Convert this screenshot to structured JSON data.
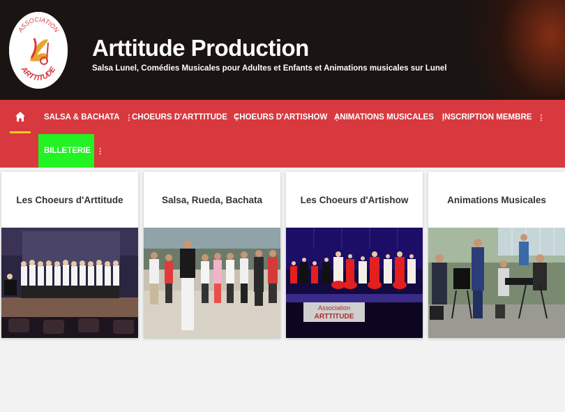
{
  "header": {
    "logo_text_top": "ASSOCIATION",
    "logo_text_bottom": "ARTTITUDE",
    "title": "Arttitude Production",
    "tagline": "Salsa Lunel, Comédies Musicales pour Adultes et Enfants et Animations musicales sur Lunel"
  },
  "nav": {
    "home_icon": "home-icon",
    "items": [
      {
        "label": "SALSA & BACHATA"
      },
      {
        "label": "CHOEURS D'ARTTITUDE"
      },
      {
        "label": "CHOEURS D'ARTISHOW"
      },
      {
        "label": "ANIMATIONS MUSICALES"
      },
      {
        "label": "INSCRIPTION MEMBRE"
      }
    ],
    "ticket": {
      "label": "BILLETERIE"
    },
    "dots": "⋮"
  },
  "cards": [
    {
      "title": "Les Choeurs d'Arttitude"
    },
    {
      "title": "Salsa, Rueda, Bachata"
    },
    {
      "title": "Les Choeurs d'Artishow"
    },
    {
      "title": "Animations Musicales"
    }
  ],
  "photo3_banner": {
    "line1": "Association",
    "line2": "ARTTITUDE"
  },
  "colors": {
    "nav_bg": "#d8393e",
    "ticket_bg": "#22f322",
    "active_underline": "#f3c623",
    "header_bg": "#1a1412"
  }
}
